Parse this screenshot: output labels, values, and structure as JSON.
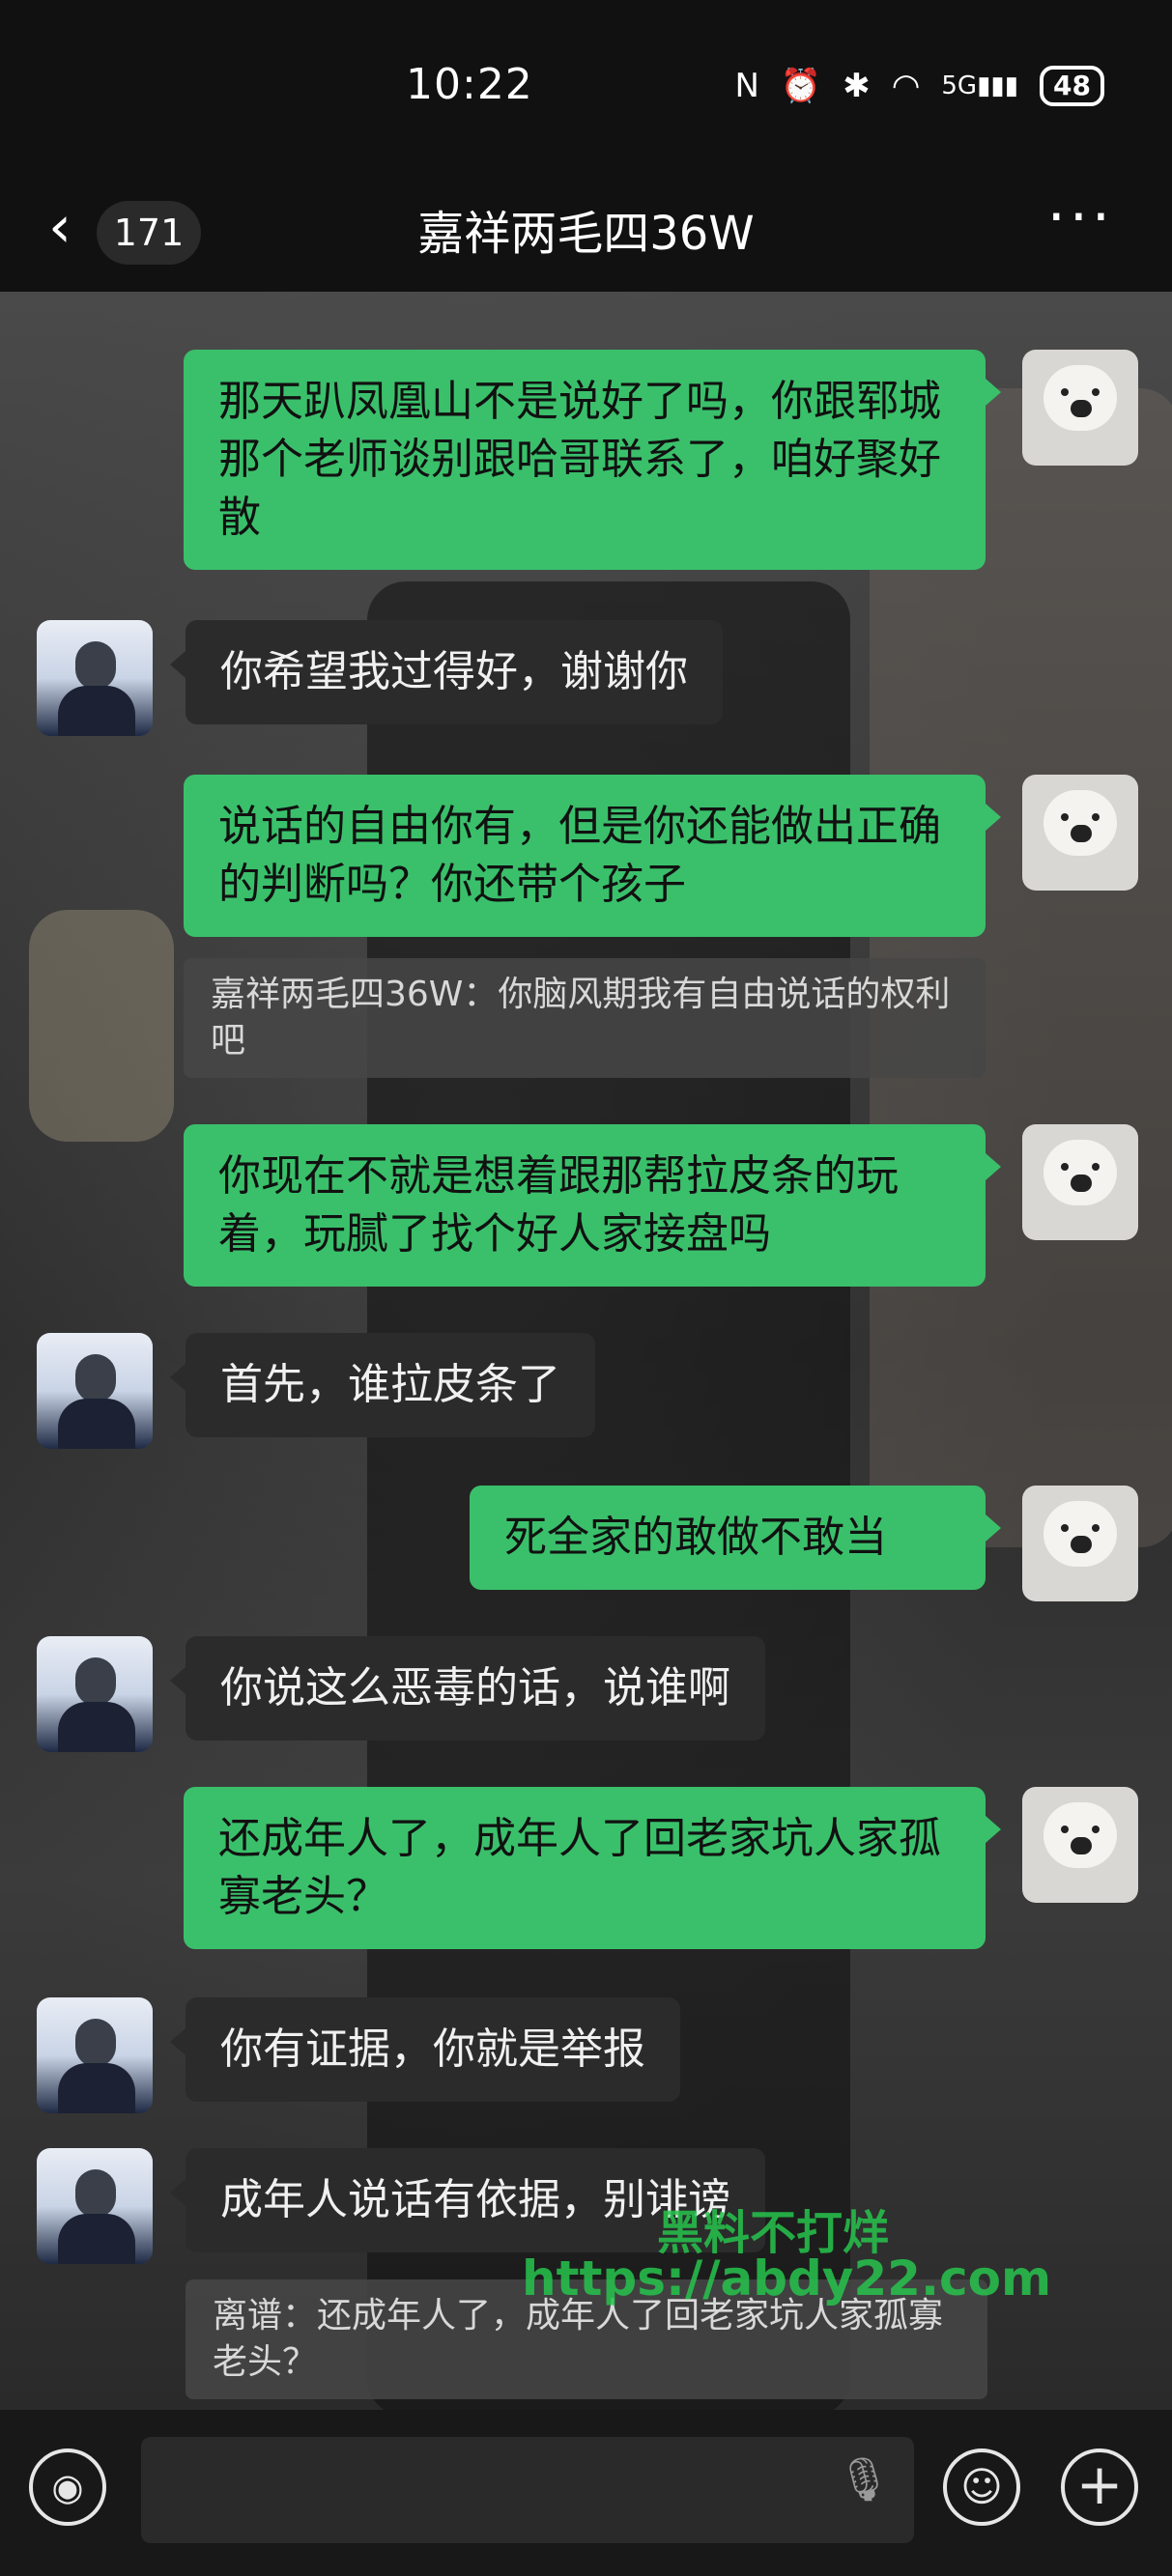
{
  "status": {
    "time": "10:22",
    "battery": "48",
    "network": "5G"
  },
  "header": {
    "unread_count": "171",
    "title": "嘉祥两毛四36W"
  },
  "messages": [
    {
      "text": "那天趴凤凰山不是说好了吗，你跟郓城那个老师谈别跟哈哥联系了，咱好聚好散"
    },
    {
      "text": "你希望我过得好，谢谢你"
    },
    {
      "text": "说话的自由你有，但是你还能做出正确的判断吗？你还带个孩子"
    },
    {
      "quote": "嘉祥两毛四36W：你脑风期我有自由说话的权利吧"
    },
    {
      "text": "你现在不就是想着跟那帮拉皮条的玩着，玩腻了找个好人家接盘吗"
    },
    {
      "text": "首先，谁拉皮条了"
    },
    {
      "text": "死全家的敢做不敢当"
    },
    {
      "text": "你说这么恶毒的话，说谁啊"
    },
    {
      "text": "还成年人了，成年人了回老家坑人家孤寡老头？"
    },
    {
      "text": "你有证据，你就是举报"
    },
    {
      "text": "成年人说话有依据，别诽谤"
    },
    {
      "quote": "离谱：还成年人了，成年人了回老家坑人家孤寡老头？"
    }
  ],
  "watermark": {
    "line1": "黑料不打烊",
    "line2": "https://abdy22.com"
  },
  "colors": {
    "outgoing": "#3ac06b",
    "incoming": "#2b2b2b",
    "watermark": "#27c44d"
  },
  "icons": {
    "voice": "voice-icon",
    "mic": "mic-icon",
    "emoji": "emoji-icon",
    "plus": "plus-icon",
    "back": "back-arrow-icon",
    "more": "more-icon"
  }
}
